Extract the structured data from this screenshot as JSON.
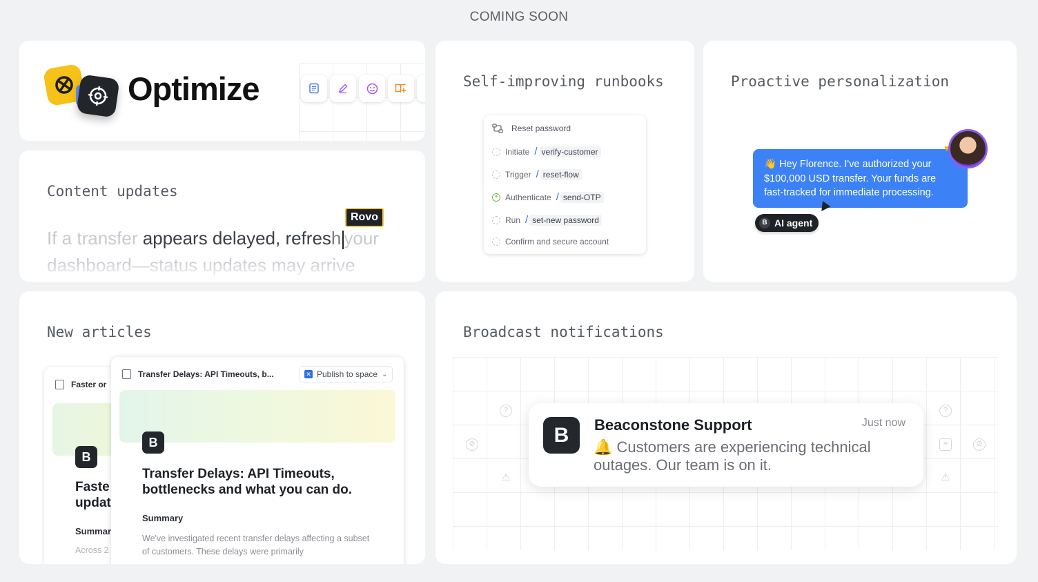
{
  "header": {
    "title": "COMING SOON"
  },
  "optimize": {
    "title": "Optimize"
  },
  "content_updates": {
    "title": "Content updates",
    "text_light_1": "If a transfer ",
    "text_dark": "appears delayed, refres",
    "text_mid": "h",
    "text_light_2": "your dashboard—status updates may arrive",
    "rovo_label": "Rovo"
  },
  "runbooks": {
    "title": "Self-improving runbooks",
    "heading": "Reset password",
    "steps": [
      {
        "label": "Initiate",
        "command": "verify-customer"
      },
      {
        "label": "Trigger",
        "command": "reset-flow"
      },
      {
        "label": "Authenticate",
        "command": "send-OTP"
      },
      {
        "label": "Run",
        "command": "set-new password"
      },
      {
        "label": "Confirm and secure account",
        "command": ""
      }
    ]
  },
  "personalization": {
    "title": "Proactive personalization",
    "message": "👋 Hey Florence. I've authorized your $100,000 USD transfer. Your funds are fast-tracked for immediate processing.",
    "agent_label": "AI agent"
  },
  "articles": {
    "title": "New articles",
    "back_header": "Faster or",
    "back_title": "Faste updat",
    "back_summary": "Summar",
    "back_body": "Across 2",
    "front_header": "Transfer Delays: API Timeouts, b...",
    "publish_label": "Publish to space",
    "front_title": "Transfer Delays: API Timeouts, bottlenecks and what you can do.",
    "summary_label": "Summary",
    "summary_text": "We've investigated recent transfer delays affecting a subset of customers. These delays were primarily"
  },
  "broadcast": {
    "title": "Broadcast notifications",
    "sender": "Beaconstone Support",
    "time": "Just now",
    "message": "🔔 Customers are experiencing technical outages. Our team is on it."
  }
}
